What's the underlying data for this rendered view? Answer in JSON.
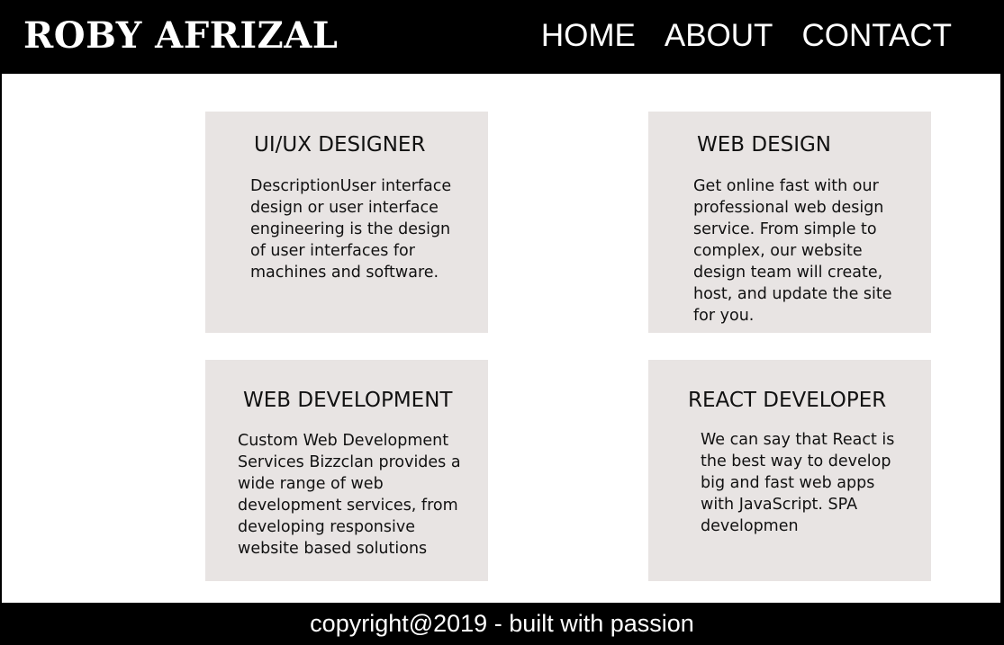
{
  "header": {
    "brand": "ROBY AFRIZAL",
    "nav": [
      "HOME",
      "ABOUT",
      "CONTACT"
    ]
  },
  "cards": [
    {
      "title": "UI/UX DESIGNER",
      "description": "DescriptionUser interface design or user interface engineering is the design of user interfaces for machines and software."
    },
    {
      "title": "WEB DESIGN",
      "description": "Get online fast with our professional web design service. From simple to complex, our website design team will create, host, and update the site for you."
    },
    {
      "title": "WEB DEVELOPMENT",
      "description": "Custom Web Development Services Bizzclan provides a wide range of web development services, from developing responsive website based solutions"
    },
    {
      "title": "REACT DEVELOPER",
      "description": "We can say that React is the best way to develop big and fast web apps with JavaScript. SPA developmen"
    }
  ],
  "footer": {
    "text": "copyright@2019 - built with passion"
  },
  "colors": {
    "header_bg": "#000000",
    "page_bg": "#ffffff",
    "card_bg": "#e8e4e3",
    "text": "#111111"
  }
}
